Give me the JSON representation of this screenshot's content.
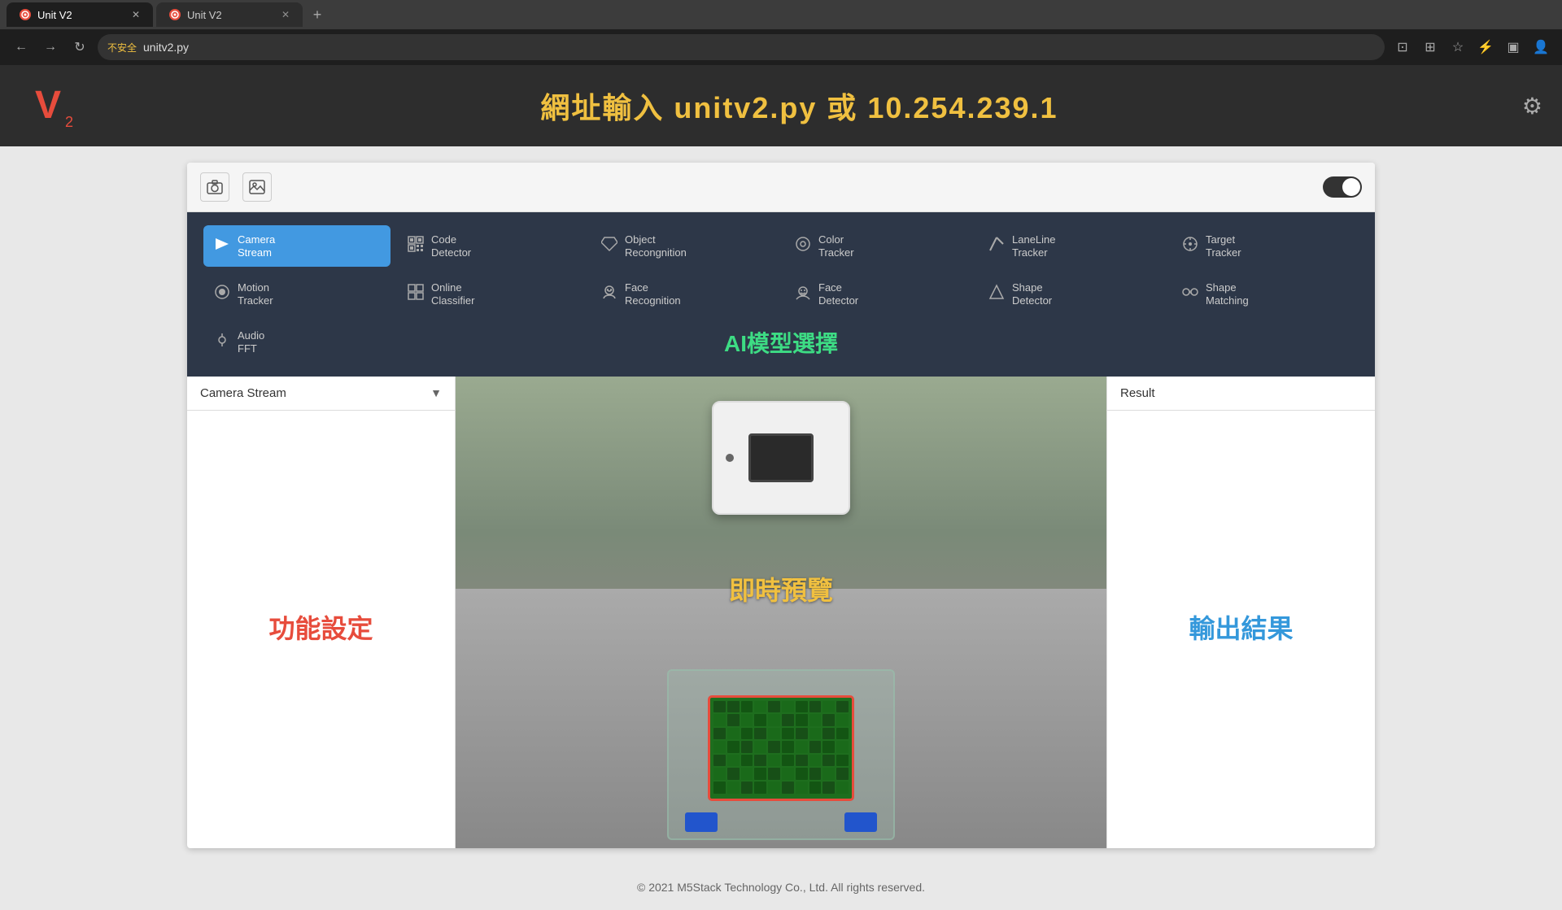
{
  "browser": {
    "tabs": [
      {
        "id": "tab1",
        "label": "Unit V2",
        "active": true,
        "favicon": "V"
      },
      {
        "id": "tab2",
        "label": "Unit V2",
        "active": false,
        "favicon": "V"
      }
    ],
    "address": "unitv2.py",
    "warning_text": "不安全",
    "new_tab_label": "+"
  },
  "page_header": {
    "logo": "V",
    "logo_subscript": "2",
    "banner_text": "網址輸入 unitv2.py 或 10.254.239.1"
  },
  "toolbar": {
    "camera_icon": "📷",
    "image_icon": "🖼",
    "toggle_state": "on"
  },
  "nav_menu": {
    "items": [
      {
        "id": "camera-stream",
        "icon": "▷",
        "label": "Camera\nStream",
        "active": true
      },
      {
        "id": "code-detector",
        "icon": "⊞",
        "label": "Code\nDetector",
        "active": false
      },
      {
        "id": "object-recognition",
        "icon": "◇",
        "label": "Object\nRecongnition",
        "active": false
      },
      {
        "id": "color-tracker",
        "icon": "◎",
        "label": "Color\nTracker",
        "active": false
      },
      {
        "id": "laneline-tracker",
        "icon": "↗",
        "label": "LaneLine\nTracker",
        "active": false
      },
      {
        "id": "target-tracker",
        "icon": "⊕",
        "label": "Target\nTracker",
        "active": false
      },
      {
        "id": "motion-tracker",
        "icon": "◉",
        "label": "Motion\nTracker",
        "active": false
      },
      {
        "id": "online-classifier",
        "icon": "▣",
        "label": "Online\nClassifier",
        "active": false
      },
      {
        "id": "face-recognition",
        "icon": "☺",
        "label": "Face\nRecognition",
        "active": false
      },
      {
        "id": "face-detector",
        "icon": "☻",
        "label": "Face\nDetector",
        "active": false
      },
      {
        "id": "shape-detector",
        "icon": "✦",
        "label": "Shape\nDetector",
        "active": false
      },
      {
        "id": "shape-matching",
        "icon": "⟳",
        "label": "Shape\nMatching",
        "active": false
      },
      {
        "id": "audio-fft",
        "icon": "🎵",
        "label": "Audio\nFFT",
        "active": false
      }
    ]
  },
  "ai_overlay_text": "AI模型選擇",
  "left_panel": {
    "header": "Camera Stream",
    "settings_label": "功能設定"
  },
  "center_panel": {
    "preview_label": "即時預覽"
  },
  "right_panel": {
    "header": "Result",
    "result_label": "輸出結果"
  },
  "footer": {
    "text": "© 2021 M5Stack Technology Co., Ltd. All rights reserved."
  }
}
